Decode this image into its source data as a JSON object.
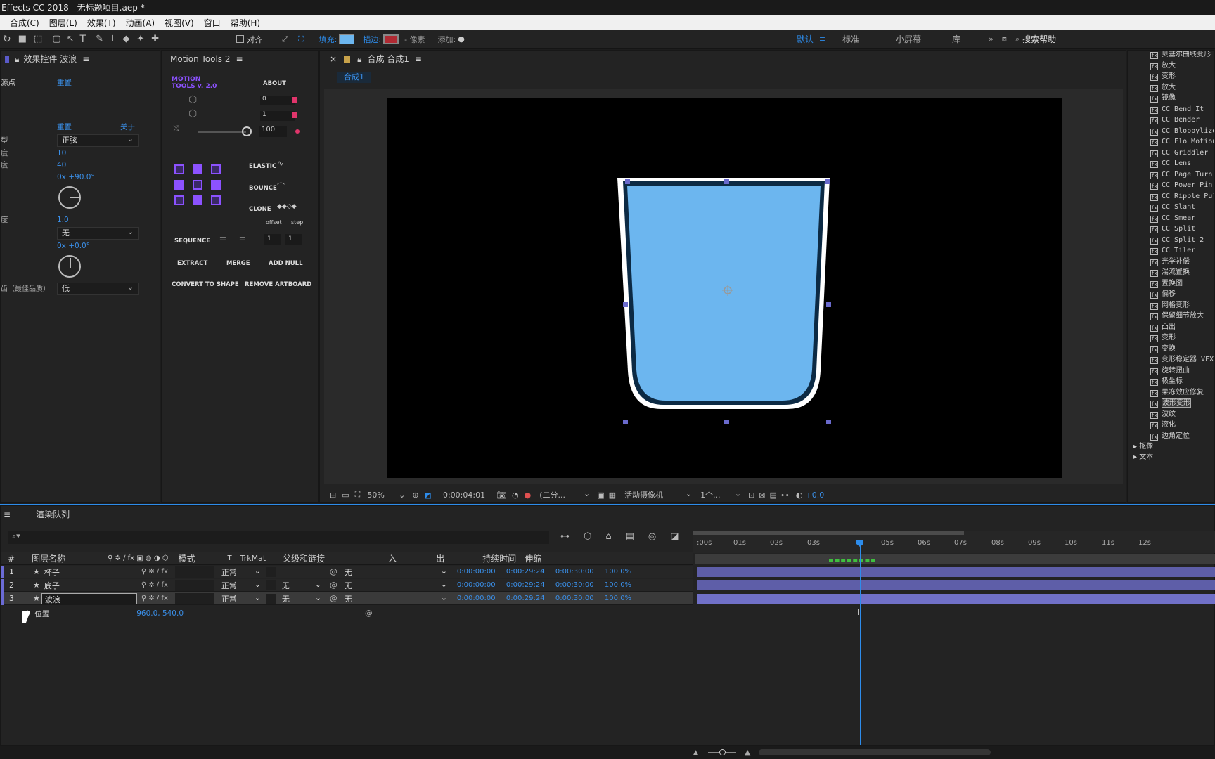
{
  "window": {
    "title": "Effects CC 2018 - 无标题项目.aep *",
    "minimize": "—"
  },
  "menu": [
    "合成(C)",
    "图层(L)",
    "效果(T)",
    "动画(A)",
    "视图(V)",
    "窗口",
    "帮助(H)"
  ],
  "toolbar": {
    "align": "对齐",
    "fill": "填充:",
    "stroke": "描边:",
    "px": "- 像素",
    "add": "添加:",
    "workspaces": [
      "默认",
      "标准",
      "小屏幕",
      "库"
    ],
    "search": "搜索帮助",
    "fill_color": "#6cb6ef",
    "stroke_color": "#b02a33"
  },
  "effects_panel": {
    "tab": "效果控件 波浪",
    "rows": [
      {
        "label": "源点",
        "value": "重置"
      },
      {
        "label": "",
        "value": ""
      },
      {
        "label": "",
        "value": ""
      },
      {
        "label": "",
        "value": "重置",
        "extra": "关于"
      },
      {
        "label": "型",
        "value": "正弦"
      },
      {
        "label": "度",
        "value": "10"
      },
      {
        "label": "度",
        "value": "40"
      },
      {
        "label": "",
        "value": "0x +90.0°"
      },
      {
        "label": "度",
        "value": "1.0"
      },
      {
        "label": "",
        "value": "无"
      },
      {
        "label": "",
        "value": "0x +0.0°"
      },
      {
        "label": "齿（最佳品质）",
        "value": "低"
      }
    ]
  },
  "motion_tools": {
    "tab": "Motion Tools 2",
    "logo1": "MOTION",
    "logo2": "TOOLS v. 2.0",
    "about": "ABOUT",
    "val0": "0",
    "val1": "1",
    "slider": "100",
    "elastic": "ELASTIC",
    "bounce": "BOUNCE",
    "clone": "CLONE",
    "offset": "offset",
    "step": "step",
    "sequence": "SEQUENCE",
    "seq1": "1",
    "seq2": "1",
    "extract": "EXTRACT",
    "merge": "MERGE",
    "addnull": "ADD NULL",
    "convert": "CONVERT TO SHAPE",
    "remove": "REMOVE ARTBOARD"
  },
  "comp_panel": {
    "tab": "合成 合成1",
    "subtab": "合成1",
    "zoom": "50%",
    "time": "0:00:04:01",
    "resolution": "(二分...",
    "camera": "活动摄像机",
    "views": "1个...",
    "exposure": "+0.0"
  },
  "effects_list": [
    "贝塞尔曲线变形",
    "放大",
    "变形",
    "放大",
    "镜像",
    "CC Bend It",
    "CC Bender",
    "CC Blobbylize",
    "CC Flo Motion",
    "CC Griddler",
    "CC Lens",
    "CC Page Turn",
    "CC Power Pin",
    "CC Ripple Pulse",
    "CC Slant",
    "CC Smear",
    "CC Split",
    "CC Split 2",
    "CC Tiler",
    "光学补偿",
    "湍流置换",
    "置换图",
    "偏移",
    "网格变形",
    "保留细节放大",
    "凸出",
    "变形",
    "变换",
    "变形稳定器 VFX",
    "旋转扭曲",
    "极坐标",
    "果冻效应修复",
    "波形变形",
    "波纹",
    "液化",
    "边角定位"
  ],
  "effects_folders": [
    "抠像",
    "文本"
  ],
  "timeline": {
    "tab": "渲染队列",
    "cols": [
      "#",
      "图层名称",
      "模式",
      "T",
      "TrkMat",
      "父级和链接",
      "入",
      "出",
      "持续时间",
      "伸缩"
    ],
    "layers": [
      {
        "num": "1",
        "name": "杯子",
        "mode": "正常",
        "trk": "",
        "parent": "无",
        "in": "0:00:00:00",
        "out": "0:00:29:24",
        "dur": "0:00:30:00",
        "str": "100.0%"
      },
      {
        "num": "2",
        "name": "底子",
        "mode": "正常",
        "trk": "无",
        "parent": "无",
        "in": "0:00:00:00",
        "out": "0:00:29:24",
        "dur": "0:00:30:00",
        "str": "100.0%"
      },
      {
        "num": "3",
        "name": "波浪",
        "mode": "正常",
        "trk": "无",
        "parent": "无",
        "in": "0:00:00:00",
        "out": "0:00:29:24",
        "dur": "0:00:30:00",
        "str": "100.0%"
      }
    ],
    "prop_name": "位置",
    "prop_value": "960.0, 540.0",
    "ruler": [
      ":00s",
      "01s",
      "02s",
      "03s",
      "05s",
      "06s",
      "07s",
      "08s",
      "09s",
      "10s",
      "11s",
      "12s"
    ]
  }
}
